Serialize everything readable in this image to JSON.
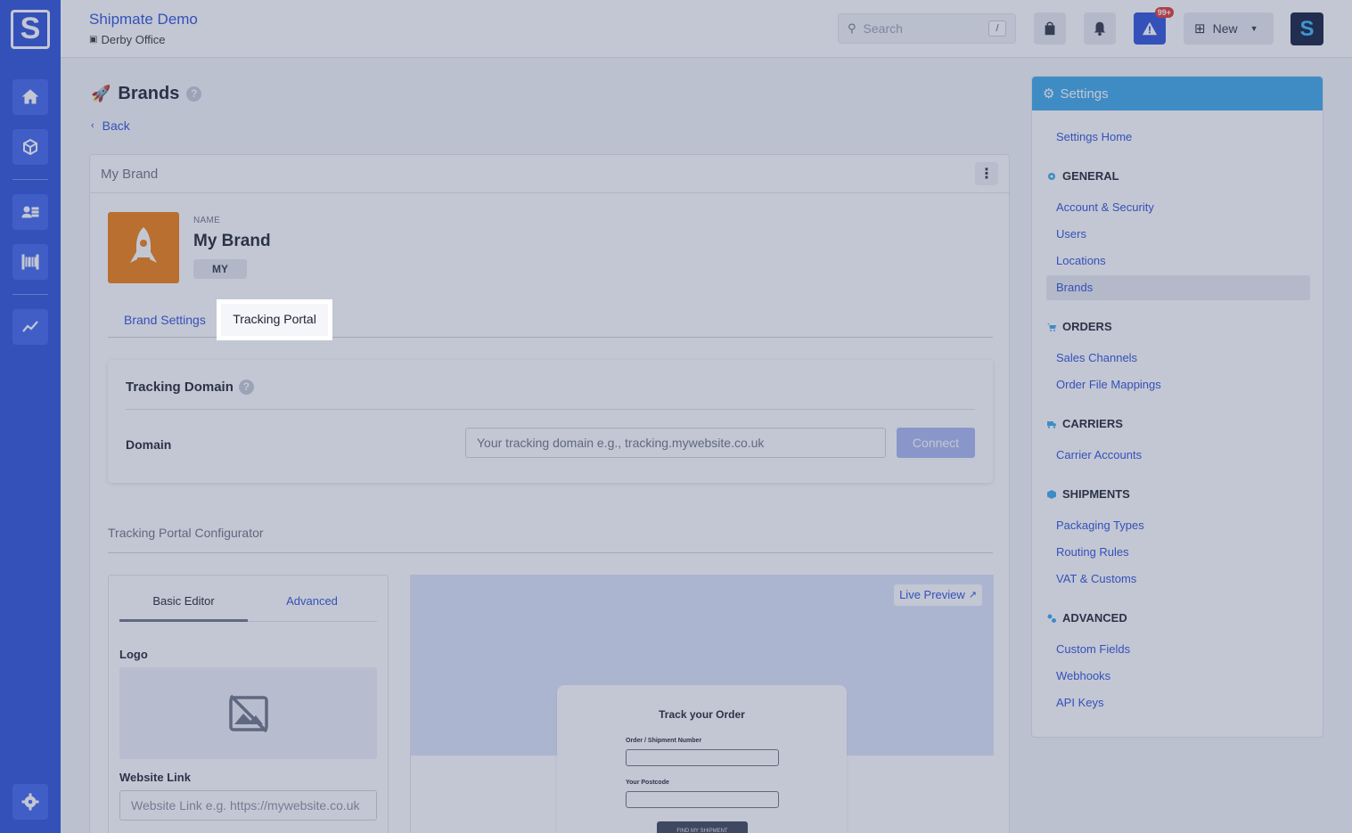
{
  "app": {
    "org_name": "Shipmate Demo",
    "org_location": "Derby Office",
    "logo_letter": "S"
  },
  "topbar": {
    "search_placeholder": "Search",
    "search_shortcut": "/",
    "alert_badge": "99+",
    "new_label": "New"
  },
  "rail": {
    "items": [
      "home-icon",
      "box-icon",
      "contacts-icon",
      "barcode-icon",
      "chart-icon",
      "gear-icon"
    ]
  },
  "page": {
    "title": "Brands",
    "back_label": "Back"
  },
  "brand_card": {
    "header": "My Brand",
    "name_label": "NAME",
    "name_value": "My Brand",
    "code": "MY",
    "tabs": [
      "Brand Settings",
      "Tracking Portal"
    ],
    "active_tab": "Tracking Portal"
  },
  "tracking_domain": {
    "title": "Tracking Domain",
    "domain_label": "Domain",
    "domain_placeholder": "Your tracking domain e.g., tracking.mywebsite.co.uk",
    "connect_label": "Connect"
  },
  "configurator": {
    "title": "Tracking Portal Configurator",
    "editor_tabs": [
      "Basic Editor",
      "Advanced"
    ],
    "logo_label": "Logo",
    "website_label": "Website Link",
    "website_placeholder": "Website Link e.g. https://mywebsite.co.uk",
    "live_preview_label": "Live Preview",
    "preview": {
      "title": "Track your Order",
      "field1": "Order / Shipment Number",
      "field2": "Your Postcode",
      "button": "FIND MY SHIPMENT"
    }
  },
  "settings_panel": {
    "title": "Settings",
    "home": "Settings Home",
    "sections": [
      {
        "title": "GENERAL",
        "links": [
          "Account & Security",
          "Users",
          "Locations",
          "Brands"
        ]
      },
      {
        "title": "ORDERS",
        "links": [
          "Sales Channels",
          "Order File Mappings"
        ]
      },
      {
        "title": "CARRIERS",
        "links": [
          "Carrier Accounts"
        ]
      },
      {
        "title": "SHIPMENTS",
        "links": [
          "Packaging Types",
          "Routing Rules",
          "VAT & Customs"
        ]
      },
      {
        "title": "ADVANCED",
        "links": [
          "Custom Fields",
          "Webhooks",
          "API Keys"
        ]
      }
    ],
    "active_link": "Brands"
  },
  "colors": {
    "primary": "#2a4fd9",
    "settings_header": "#3ba7ea",
    "brand_logo": "#ef7d0d",
    "alert": "#e3342f"
  }
}
